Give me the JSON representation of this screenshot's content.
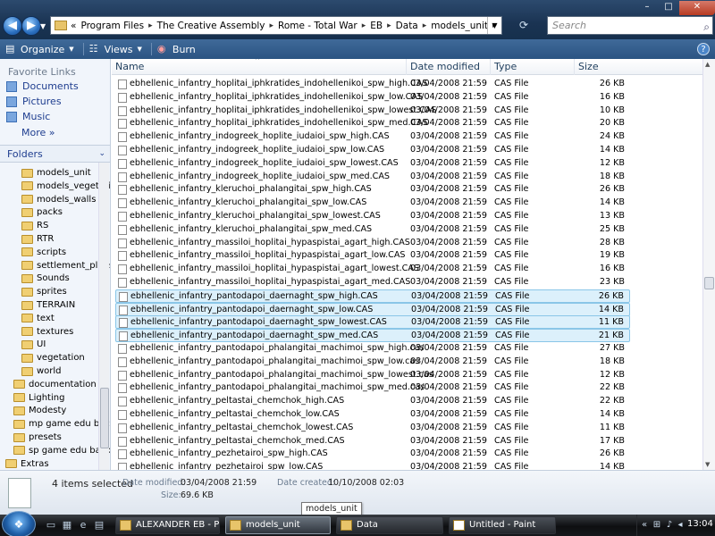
{
  "window": {
    "minimize": "–",
    "maximize": "□",
    "close": "✕"
  },
  "address": {
    "overflow": "«",
    "crumbs": [
      "Program Files",
      "The Creative Assembly",
      "Rome - Total War",
      "EB",
      "Data",
      "models_unit"
    ],
    "search_placeholder": "Search"
  },
  "toolbar": {
    "organize": "Organize",
    "views": "Views",
    "burn": "Burn"
  },
  "nav": {
    "favorite_links": "Favorite Links",
    "links": [
      "Documents",
      "Pictures",
      "Music"
    ],
    "more": "More",
    "folders": "Folders",
    "tree": [
      {
        "label": "models_unit",
        "indent": 2,
        "selected": true
      },
      {
        "label": "models_vegetati",
        "indent": 2
      },
      {
        "label": "models_walls",
        "indent": 2
      },
      {
        "label": "packs",
        "indent": 2
      },
      {
        "label": "RS",
        "indent": 2
      },
      {
        "label": "RTR",
        "indent": 2
      },
      {
        "label": "scripts",
        "indent": 2
      },
      {
        "label": "settlement_plans",
        "indent": 2
      },
      {
        "label": "Sounds",
        "indent": 2
      },
      {
        "label": "sprites",
        "indent": 2
      },
      {
        "label": "TERRAIN",
        "indent": 2
      },
      {
        "label": "text",
        "indent": 2
      },
      {
        "label": "textures",
        "indent": 2
      },
      {
        "label": "UI",
        "indent": 2
      },
      {
        "label": "vegetation",
        "indent": 2
      },
      {
        "label": "world",
        "indent": 2
      },
      {
        "label": "documentation",
        "indent": 1
      },
      {
        "label": "Lighting",
        "indent": 1
      },
      {
        "label": "Modesty",
        "indent": 1
      },
      {
        "label": "mp game edu bac",
        "indent": 1
      },
      {
        "label": "presets",
        "indent": 1
      },
      {
        "label": "sp game edu back",
        "indent": 1
      },
      {
        "label": "Extras",
        "indent": 0
      },
      {
        "label": "...",
        "indent": 0
      }
    ]
  },
  "columns": {
    "name": "Name",
    "date": "Date modified",
    "type": "Type",
    "size": "Size"
  },
  "files": [
    {
      "name": "ebhellenic_infantry_hoplitai_iphkratides_indohellenikoi_spw_high.CAS",
      "date": "03/04/2008 21:59",
      "type": "CAS File",
      "size": "26 KB"
    },
    {
      "name": "ebhellenic_infantry_hoplitai_iphkratides_indohellenikoi_spw_low.CAS",
      "date": "03/04/2008 21:59",
      "type": "CAS File",
      "size": "16 KB"
    },
    {
      "name": "ebhellenic_infantry_hoplitai_iphkratides_indohellenikoi_spw_lowest.CAS",
      "date": "03/04/2008 21:59",
      "type": "CAS File",
      "size": "10 KB"
    },
    {
      "name": "ebhellenic_infantry_hoplitai_iphkratides_indohellenikoi_spw_med.CAS",
      "date": "03/04/2008 21:59",
      "type": "CAS File",
      "size": "20 KB"
    },
    {
      "name": "ebhellenic_infantry_indogreek_hoplite_iudaioi_spw_high.CAS",
      "date": "03/04/2008 21:59",
      "type": "CAS File",
      "size": "24 KB"
    },
    {
      "name": "ebhellenic_infantry_indogreek_hoplite_iudaioi_spw_low.CAS",
      "date": "03/04/2008 21:59",
      "type": "CAS File",
      "size": "14 KB"
    },
    {
      "name": "ebhellenic_infantry_indogreek_hoplite_iudaioi_spw_lowest.CAS",
      "date": "03/04/2008 21:59",
      "type": "CAS File",
      "size": "12 KB"
    },
    {
      "name": "ebhellenic_infantry_indogreek_hoplite_iudaioi_spw_med.CAS",
      "date": "03/04/2008 21:59",
      "type": "CAS File",
      "size": "18 KB"
    },
    {
      "name": "ebhellenic_infantry_kleruchoi_phalangitai_spw_high.CAS",
      "date": "03/04/2008 21:59",
      "type": "CAS File",
      "size": "26 KB"
    },
    {
      "name": "ebhellenic_infantry_kleruchoi_phalangitai_spw_low.CAS",
      "date": "03/04/2008 21:59",
      "type": "CAS File",
      "size": "14 KB"
    },
    {
      "name": "ebhellenic_infantry_kleruchoi_phalangitai_spw_lowest.CAS",
      "date": "03/04/2008 21:59",
      "type": "CAS File",
      "size": "13 KB"
    },
    {
      "name": "ebhellenic_infantry_kleruchoi_phalangitai_spw_med.CAS",
      "date": "03/04/2008 21:59",
      "type": "CAS File",
      "size": "25 KB"
    },
    {
      "name": "ebhellenic_infantry_massiloi_hoplitai_hypaspistai_agart_high.CAS",
      "date": "03/04/2008 21:59",
      "type": "CAS File",
      "size": "28 KB"
    },
    {
      "name": "ebhellenic_infantry_massiloi_hoplitai_hypaspistai_agart_low.CAS",
      "date": "03/04/2008 21:59",
      "type": "CAS File",
      "size": "19 KB"
    },
    {
      "name": "ebhellenic_infantry_massiloi_hoplitai_hypaspistai_agart_lowest.CAS",
      "date": "03/04/2008 21:59",
      "type": "CAS File",
      "size": "16 KB"
    },
    {
      "name": "ebhellenic_infantry_massiloi_hoplitai_hypaspistai_agart_med.CAS",
      "date": "03/04/2008 21:59",
      "type": "CAS File",
      "size": "23 KB"
    },
    {
      "name": "ebhellenic_infantry_pantodapoi_daernaght_spw_high.CAS",
      "date": "03/04/2008 21:59",
      "type": "CAS File",
      "size": "26 KB",
      "selected": true
    },
    {
      "name": "ebhellenic_infantry_pantodapoi_daernaght_spw_low.CAS",
      "date": "03/04/2008 21:59",
      "type": "CAS File",
      "size": "14 KB",
      "selected": true
    },
    {
      "name": "ebhellenic_infantry_pantodapoi_daernaght_spw_lowest.CAS",
      "date": "03/04/2008 21:59",
      "type": "CAS File",
      "size": "11 KB",
      "selected": true
    },
    {
      "name": "ebhellenic_infantry_pantodapoi_daernaght_spw_med.CAS",
      "date": "03/04/2008 21:59",
      "type": "CAS File",
      "size": "21 KB",
      "selected": true
    },
    {
      "name": "ebhellenic_infantry_pantodapoi_phalangitai_machimoi_spw_high.cas",
      "date": "03/04/2008 21:59",
      "type": "CAS File",
      "size": "27 KB"
    },
    {
      "name": "ebhellenic_infantry_pantodapoi_phalangitai_machimoi_spw_low.cas",
      "date": "03/04/2008 21:59",
      "type": "CAS File",
      "size": "18 KB"
    },
    {
      "name": "ebhellenic_infantry_pantodapoi_phalangitai_machimoi_spw_lowest.cas",
      "date": "03/04/2008 21:59",
      "type": "CAS File",
      "size": "12 KB"
    },
    {
      "name": "ebhellenic_infantry_pantodapoi_phalangitai_machimoi_spw_med.cas",
      "date": "03/04/2008 21:59",
      "type": "CAS File",
      "size": "22 KB"
    },
    {
      "name": "ebhellenic_infantry_peltastai_chemchok_high.CAS",
      "date": "03/04/2008 21:59",
      "type": "CAS File",
      "size": "22 KB"
    },
    {
      "name": "ebhellenic_infantry_peltastai_chemchok_low.CAS",
      "date": "03/04/2008 21:59",
      "type": "CAS File",
      "size": "14 KB"
    },
    {
      "name": "ebhellenic_infantry_peltastai_chemchok_lowest.CAS",
      "date": "03/04/2008 21:59",
      "type": "CAS File",
      "size": "11 KB"
    },
    {
      "name": "ebhellenic_infantry_peltastai_chemchok_med.CAS",
      "date": "03/04/2008 21:59",
      "type": "CAS File",
      "size": "17 KB"
    },
    {
      "name": "ebhellenic_infantry_pezhetairoi_spw_high.CAS",
      "date": "03/04/2008 21:59",
      "type": "CAS File",
      "size": "26 KB"
    },
    {
      "name": "ebhellenic_infantry_pezhetairoi_spw_low.CAS",
      "date": "03/04/2008 21:59",
      "type": "CAS File",
      "size": "14 KB"
    }
  ],
  "details": {
    "count": "4 items selected",
    "date_modified_label": "Date modified:",
    "date_modified": "03/04/2008 21:59",
    "date_created_label": "Date created:",
    "date_created": "10/10/2008 02:03",
    "size_label": "Size:",
    "size": "69.6 KB"
  },
  "tooltip": "models_unit",
  "taskbar": {
    "tasks": [
      {
        "label": "ALEXANDER EB - Pa..."
      },
      {
        "label": "models_unit",
        "active": true
      },
      {
        "label": "Data"
      },
      {
        "label": "Untitled - Paint"
      }
    ],
    "clock": "13:04"
  }
}
